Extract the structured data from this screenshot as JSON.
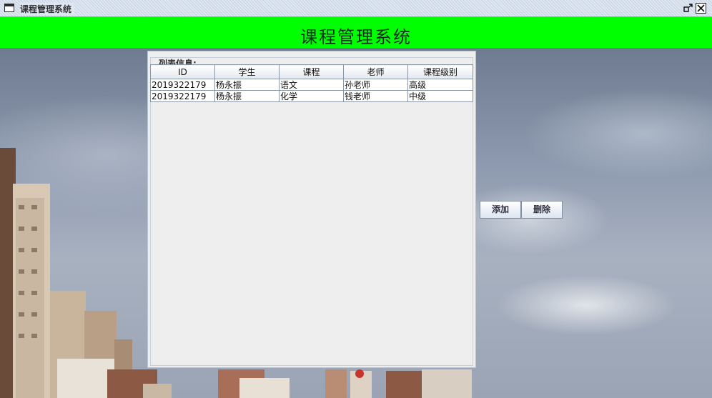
{
  "window": {
    "title": "课程管理系统",
    "icons": {
      "app": "window-icon",
      "restore": "restore-icon",
      "close": "close-icon"
    }
  },
  "header": {
    "title": "课程管理系统",
    "background": "#00ff00"
  },
  "list_panel": {
    "legend": "列表信息:",
    "columns": [
      "ID",
      "学生",
      "课程",
      "老师",
      "课程级别"
    ],
    "rows": [
      [
        "2019322179",
        "杨永振",
        "语文",
        "孙老师",
        "高级"
      ],
      [
        "2019322179",
        "杨永振",
        "化学",
        "钱老师",
        "中级"
      ]
    ]
  },
  "actions": {
    "add_label": "添加",
    "delete_label": "删除"
  }
}
